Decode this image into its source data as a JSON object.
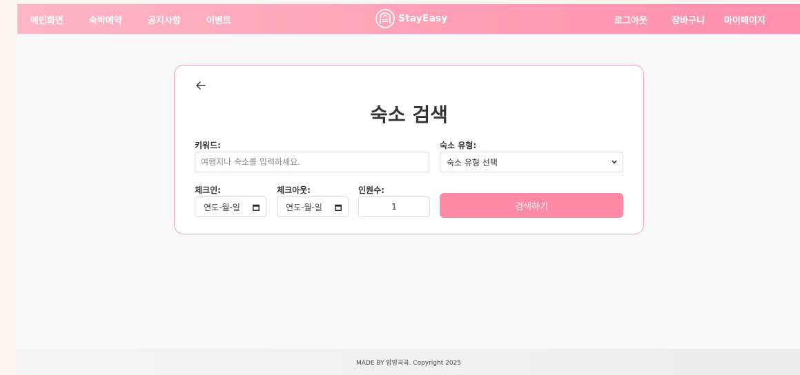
{
  "nav": {
    "left": [
      "메인화면",
      "숙박예약",
      "공지사항",
      "이벤트"
    ],
    "right": [
      "로그아웃",
      "장바구니",
      "마이페이지"
    ],
    "brand": "StayEasy",
    "brand_icon": "house-arch-logo"
  },
  "search": {
    "title": "숙소 검색",
    "keyword_label": "키워드:",
    "keyword_placeholder": "여행지나 숙소를 입력하세요.",
    "keyword_value": "",
    "type_label": "숙소 유형:",
    "type_selected": "숙소 유형 선택",
    "checkin_label": "체크인:",
    "checkin_value": "연도-월-일",
    "checkout_label": "체크아웃:",
    "checkout_value": "연도-월-일",
    "guests_label": "인원수:",
    "guests_value": "1",
    "submit_label": "검색하기"
  },
  "footer": {
    "text": "MADE BY 방방곡곡. Copyright 2025"
  },
  "colors": {
    "accent": "#ff8aa6",
    "header_start": "#ffb6c6",
    "header_end": "#ff8fae",
    "card_border": "#f5a3b4"
  }
}
